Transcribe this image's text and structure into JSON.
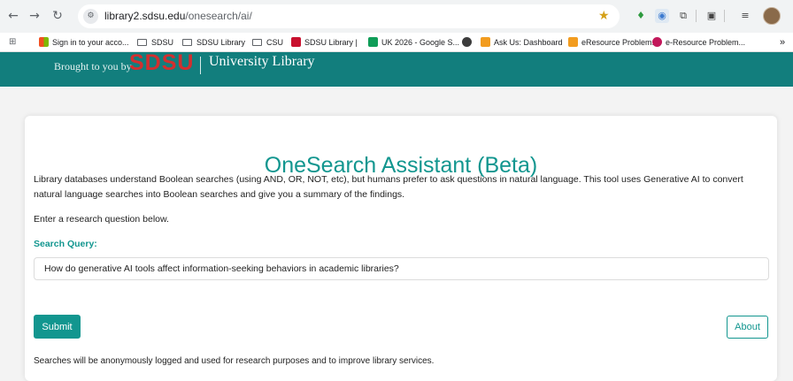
{
  "browser": {
    "url_host": "library2.sdsu.edu",
    "url_path": "/onesearch/ai/",
    "bookmarks": [
      {
        "label": "Sign in to your acco..."
      },
      {
        "label": "SDSU"
      },
      {
        "label": "SDSU Library"
      },
      {
        "label": "CSU"
      },
      {
        "label": "SDSU Library |"
      },
      {
        "label": "UK 2026 - Google S..."
      },
      {
        "label": "Ask Us: Dashboard"
      },
      {
        "label": "eResource Problem..."
      },
      {
        "label": "e-Resource Problem..."
      }
    ]
  },
  "banner": {
    "brought_by": "Brought to you by",
    "logo": "SDSU",
    "library": "University Library"
  },
  "main": {
    "title": "OneSearch Assistant (Beta)",
    "description": "Library databases understand Boolean searches (using AND, OR, NOT, etc), but humans prefer to ask questions in natural language. This tool uses Generative AI to convert natural language searches into Boolean searches and give you a summary of the findings.",
    "prompt": "Enter a research question below.",
    "query_label": "Search Query:",
    "query_value": "How do generative AI tools affect information-seeking behaviors in academic libraries?",
    "submit_label": "Submit",
    "about_label": "About",
    "footnote": "Searches will be anonymously logged and used for research purposes and to improve library services."
  },
  "colors": {
    "banner": "#127e7d",
    "accent": "#12968f",
    "logo_red": "#d22f2f"
  }
}
